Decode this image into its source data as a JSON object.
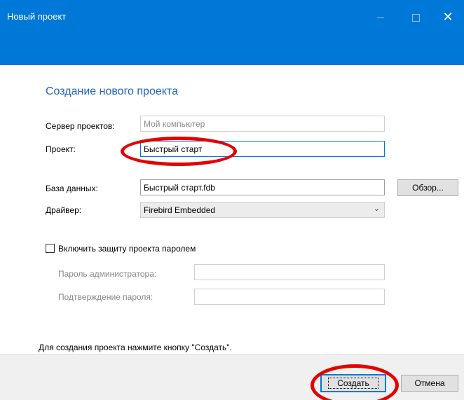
{
  "window": {
    "title": "Новый проект",
    "controls": {
      "minimize": "—",
      "maximize": "□",
      "close": "✕"
    }
  },
  "heading": "Создание нового проекта",
  "form": {
    "server_label": "Сервер проектов:",
    "server_value": "Мой компьютер",
    "project_label": "Проект:",
    "project_value": "Быстрый старт",
    "database_label": "База данных:",
    "database_value": "Быстрый старт.fdb",
    "browse_label": "Обзор...",
    "driver_label": "Драйвер:",
    "driver_value": "Firebird Embedded",
    "password_checkbox_label": "Включить защиту проекта паролем",
    "password_checked": false,
    "admin_password_label": "Пароль администратора:",
    "admin_password_value": "",
    "confirm_password_label": "Подтверждение пароля:",
    "confirm_password_value": ""
  },
  "hint": "Для создания проекта нажмите кнопку \"Создать\".",
  "footer": {
    "create_label": "Создать",
    "cancel_label": "Отмена"
  },
  "colors": {
    "titlebar": "#0078d7",
    "heading": "#1f63c6",
    "annotation": "#e60000"
  },
  "icons": {
    "minimize": "minimize-icon",
    "maximize": "maximize-icon",
    "close": "close-icon",
    "dropdown": "chevron-down-icon"
  }
}
